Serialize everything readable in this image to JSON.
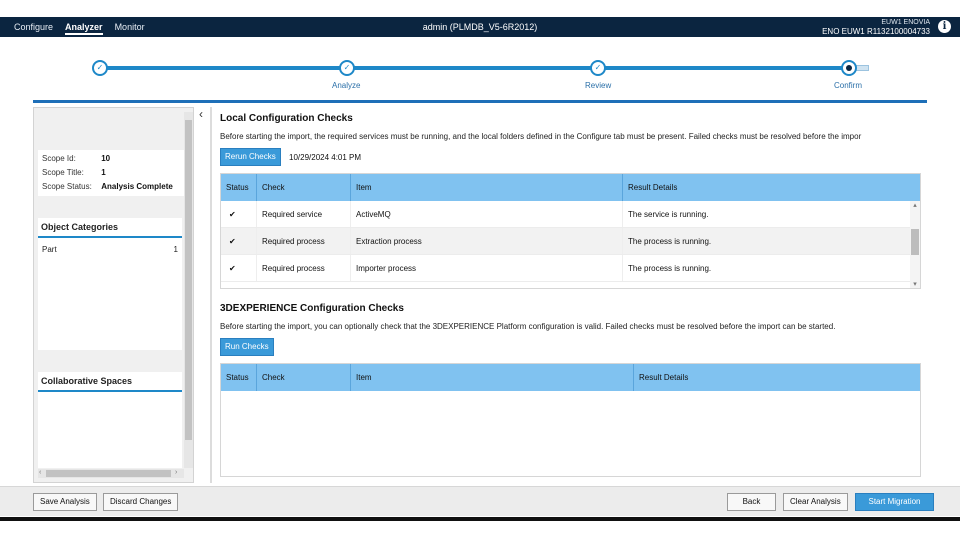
{
  "topbar": {
    "nav": [
      "Configure",
      "Analyzer",
      "Monitor"
    ],
    "active_nav": "Analyzer",
    "title": "admin (PLMDB_V5-6R2012)",
    "tenant_line1": "EUW1 ENOVIA",
    "tenant_line2": "ENO EUW1 R1132100004733",
    "info_icon": "i"
  },
  "stepper": {
    "steps": [
      "Analyze",
      "Review",
      "Confirm"
    ],
    "current_step": "Confirm"
  },
  "scope": {
    "id_label": "Scope Id:",
    "id_value": "10",
    "title_label": "Scope Title:",
    "title_value": "1",
    "status_label": "Scope Status:",
    "status_value": "Analysis Complete"
  },
  "object_categories": {
    "title": "Object Categories",
    "items": [
      {
        "name": "Part",
        "count": "1"
      }
    ]
  },
  "collaborative_spaces": {
    "title": "Collaborative Spaces"
  },
  "local_checks": {
    "title": "Local Configuration Checks",
    "description": "Before starting the import, the required services must be running, and the local folders defined in the Configure tab must be present. Failed checks must be resolved before the impor",
    "rerun_label": "Rerun Checks",
    "timestamp": "10/29/2024 4:01 PM",
    "columns": [
      "Status",
      "Check",
      "Item",
      "Result Details"
    ],
    "rows": [
      {
        "status": "✔",
        "check": "Required service",
        "item": "ActiveMQ",
        "result": "The service is running."
      },
      {
        "status": "✔",
        "check": "Required process",
        "item": "Extraction process",
        "result": "The process is running."
      },
      {
        "status": "✔",
        "check": "Required process",
        "item": "Importer process",
        "result": "The process is running."
      }
    ]
  },
  "experience_checks": {
    "title": "3DEXPERIENCE Configuration Checks",
    "description": "Before starting the import, you can optionally check that the 3DEXPERIENCE Platform configuration is valid. Failed checks must be resolved before the import can be started.",
    "run_label": "Run Checks",
    "columns": [
      "Status",
      "Check",
      "Item",
      "Result Details"
    ]
  },
  "footer_buttons": {
    "save": "Save Analysis",
    "discard": "Discard Changes",
    "back": "Back",
    "clear": "Clear Analysis",
    "start": "Start Migration"
  },
  "colors": {
    "topbar": "#0b2540",
    "accent": "#1e88c8",
    "table_header": "#80c2f0",
    "primary_button": "#3a9ad9",
    "check_green": "#2e8b2e"
  }
}
